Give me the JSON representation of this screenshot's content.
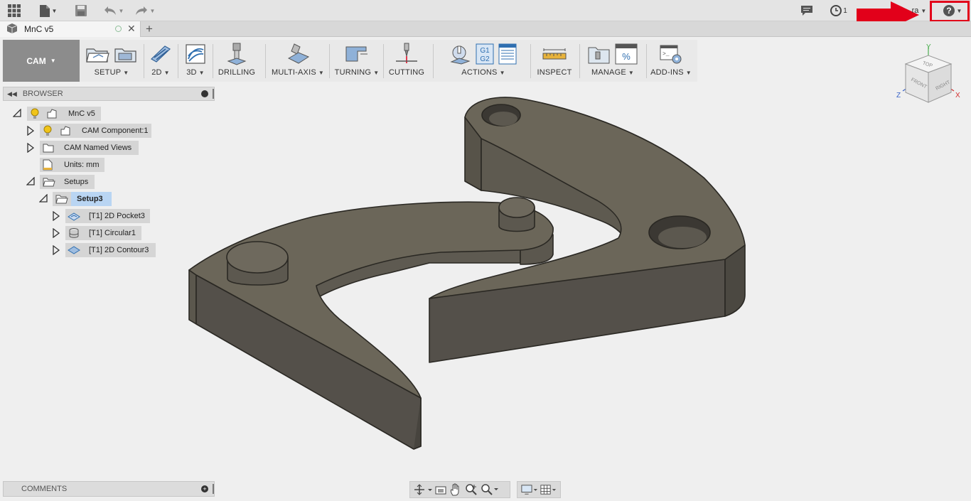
{
  "topbar": {
    "history_count": "1",
    "user_label": "ra"
  },
  "tab": {
    "title": "MnC v5"
  },
  "ribbon": {
    "workspace": "CAM",
    "groups": {
      "setup": "SETUP",
      "two_d": "2D",
      "three_d": "3D",
      "drilling": "DRILLING",
      "multi_axis": "MULTI-AXIS",
      "turning": "TURNING",
      "cutting": "CUTTING",
      "actions": "ACTIONS",
      "inspect": "INSPECT",
      "manage": "MANAGE",
      "add_ins": "ADD-INS"
    },
    "actions_icon_text": {
      "g1": "G1",
      "g2": "G2"
    }
  },
  "browser": {
    "title": "BROWSER",
    "root": "MnC v5",
    "items": {
      "cam_component": "CAM Component:1",
      "named_views": "CAM Named Views",
      "units": "Units: mm",
      "setups": "Setups",
      "setup3": "Setup3",
      "op1": "[T1] 2D Pocket3",
      "op2": "[T1] Circular1",
      "op3": "[T1] 2D Contour3"
    }
  },
  "viewcube": {
    "top": "TOP",
    "front": "FRONT",
    "right": "RIGHT",
    "axis_x": "X",
    "axis_y": "Y",
    "axis_z": "Z"
  },
  "comments": {
    "title": "COMMENTS"
  },
  "colors": {
    "highlight_red": "#e2001a",
    "part_top": "#6b6659",
    "part_side": "#57534a",
    "selection_blue": "#b9d5f3"
  }
}
